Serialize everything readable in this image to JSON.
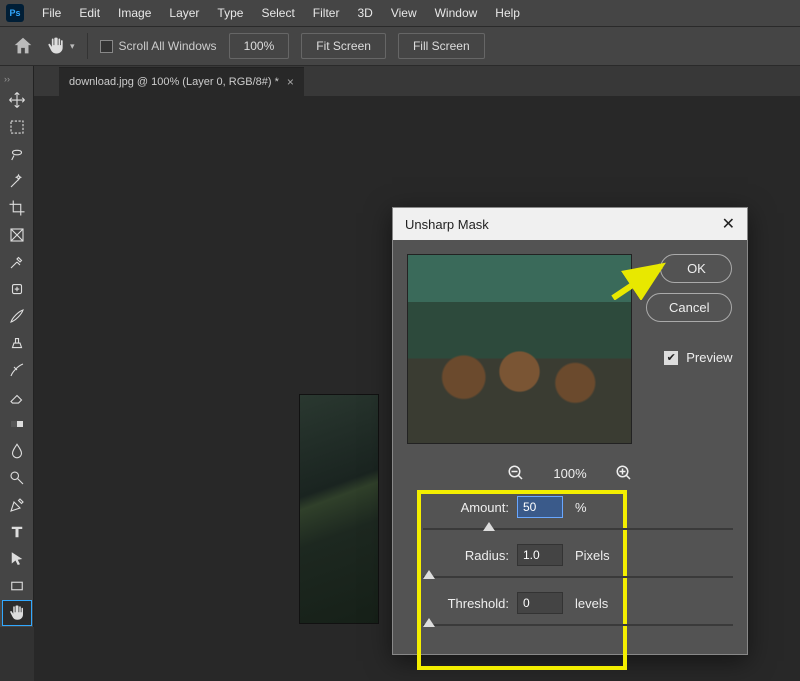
{
  "menu": [
    "File",
    "Edit",
    "Image",
    "Layer",
    "Type",
    "Select",
    "Filter",
    "3D",
    "View",
    "Window",
    "Help"
  ],
  "app_logo": "Ps",
  "options": {
    "scroll_all": "Scroll All Windows",
    "zoom": "100%",
    "fit": "Fit Screen",
    "fill": "Fill Screen"
  },
  "tab": {
    "title": "download.jpg @ 100% (Layer 0, RGB/8#) *"
  },
  "dialog": {
    "title": "Unsharp Mask",
    "ok": "OK",
    "cancel": "Cancel",
    "preview_label": "Preview",
    "preview_checked": true,
    "zoom_label": "100%",
    "amount": {
      "label": "Amount:",
      "value": "50",
      "unit": "%"
    },
    "radius": {
      "label": "Radius:",
      "value": "1.0",
      "unit": "Pixels"
    },
    "threshold": {
      "label": "Threshold:",
      "value": "0",
      "unit": "levels"
    }
  },
  "tools": [
    "move",
    "marquee",
    "lasso",
    "magic-wand",
    "crop",
    "frame",
    "eyedropper",
    "healing",
    "brush",
    "clone",
    "history-brush",
    "eraser",
    "gradient",
    "blur",
    "dodge",
    "pen",
    "type",
    "path",
    "rectangle",
    "hand"
  ]
}
